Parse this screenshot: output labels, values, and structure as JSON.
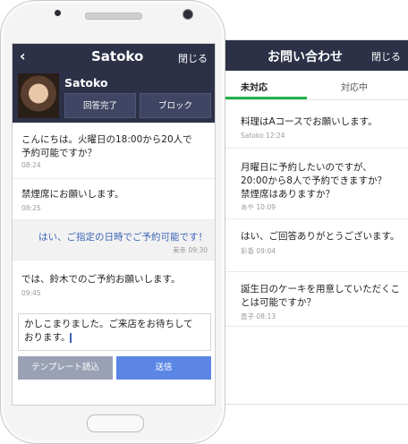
{
  "back_panel": {
    "title": "お問い合わせ",
    "close_label": "閉じる",
    "tabs": [
      {
        "label": "未対応"
      },
      {
        "label": "対応中"
      }
    ],
    "items": [
      {
        "text": "料理はAコースでお願いします。",
        "sender": "Satoko",
        "time": "12:24"
      },
      {
        "text": "月曜日に予約したいのですが、\n20:00から8人で予約できますか？\n禁煙席はありますか？",
        "sender": "あや",
        "time": "10:09"
      },
      {
        "text": "はい、ご回答ありがとうございます。",
        "sender": "彩香",
        "time": "09:04"
      },
      {
        "text": "誕生日のケーキを用意していただくこ\nとは可能ですか？",
        "sender": "直子",
        "time": "08:13"
      }
    ]
  },
  "chat": {
    "title": "Satoko",
    "close_label": "閉じる",
    "profile": {
      "name": "Satoko",
      "done_button": "回答完了",
      "block_button": "ブロック"
    },
    "messages": [
      {
        "text": "こんにちは。火曜日の18:00から20人で\n予約可能ですか？",
        "time": "08:24"
      },
      {
        "text": "禁煙席にお願いします。",
        "time": "08:25"
      }
    ],
    "reply": {
      "text": "はい、ご指定の日時でご予約可能です！",
      "sender": "美幸",
      "time": "09:30"
    },
    "last_message": {
      "text": "では、鈴木でのご予約お願いします。",
      "time": "09:45"
    },
    "input_text": "かしこまりました。ご来店をお待ちして\nおります。",
    "template_button": "テンプレート読込",
    "send_button": "送信"
  },
  "colors": {
    "header": "#2d3147",
    "accent_green": "#22b14c",
    "send_blue": "#5b86e6",
    "reply_blue": "#3b63b8"
  }
}
